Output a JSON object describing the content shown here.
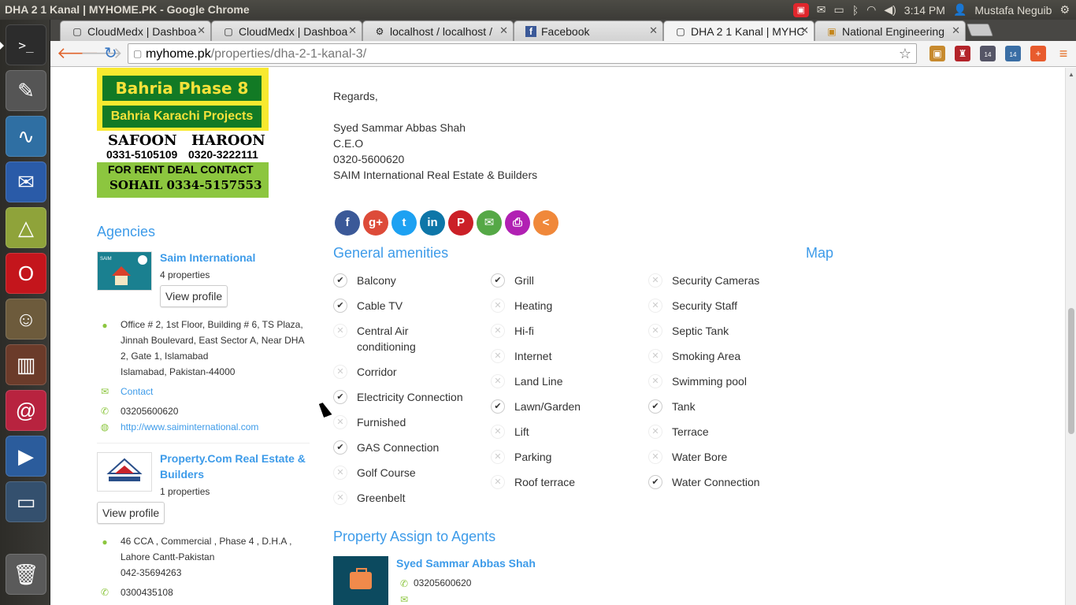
{
  "os": {
    "window_title": "DHA 2 1 Kanal | MYHOME.PK - Google Chrome",
    "clock": "3:14 PM",
    "user": "Mustafa Neguib"
  },
  "launcher": {
    "apps": [
      {
        "name": "terminal-icon",
        "color": "#2c2c2c",
        "glyph": ">_"
      },
      {
        "name": "inkscape-icon",
        "color": "#555",
        "glyph": "✎"
      },
      {
        "name": "system-monitor-icon",
        "color": "#2f6fa3",
        "glyph": "∿"
      },
      {
        "name": "thunderbird-icon",
        "color": "#2a5ba8",
        "glyph": "✉"
      },
      {
        "name": "design-tool-icon",
        "color": "#8fa33a",
        "glyph": "△"
      },
      {
        "name": "opera-icon",
        "color": "#c4151c",
        "glyph": "O"
      },
      {
        "name": "gimp-icon",
        "color": "#6d5b3c",
        "glyph": "☺"
      },
      {
        "name": "books-icon",
        "color": "#6b3b2a",
        "glyph": "▥"
      },
      {
        "name": "app-red-icon",
        "color": "#b8233f",
        "glyph": "@"
      },
      {
        "name": "media-player-icon",
        "color": "#2b5c9c",
        "glyph": "▶"
      },
      {
        "name": "image-viewer-icon",
        "color": "#34506e",
        "glyph": "▭"
      },
      {
        "name": "trash-icon",
        "color": "#5a5a5a",
        "glyph": "🗑"
      }
    ]
  },
  "browser": {
    "tabs": [
      {
        "label": "CloudMedx | Dashboa",
        "fav": "▢"
      },
      {
        "label": "CloudMedx | Dashboa",
        "fav": "▢"
      },
      {
        "label": "localhost / localhost /",
        "fav": "⚙"
      },
      {
        "label": "Facebook",
        "fav": "f"
      },
      {
        "label": "DHA 2 1 Kanal | MYHC",
        "fav": "▢"
      },
      {
        "label": "National Engineering",
        "fav": "▣"
      }
    ],
    "url_domain": "myhome.pk",
    "url_path": "/properties/dha-2-1-kanal-3/",
    "ext_badge_1": "14",
    "ext_badge_2": "14"
  },
  "banner": {
    "line1": "Bahria Phase 8",
    "line2": "Bahria Karachi Projects",
    "name1": "SAFOON",
    "name2": "HAROON",
    "phone1": "0331-5105109",
    "phone2": "0320-3222111",
    "deal": "FOR RENT DEAL CONTACT",
    "contact": "SOHAIL  0334-5157553"
  },
  "agencies": {
    "title": "Agencies",
    "items": [
      {
        "name": "Saim International",
        "count": "4 properties",
        "view_label": "View profile",
        "address1": "Office # 2, 1st Floor, Building # 6, TS Plaza,",
        "address2": "Jinnah Boulevard, East Sector A, Near DHA",
        "address3": "2, Gate 1, Islamabad",
        "address4": "Islamabad, Pakistan-44000",
        "contact": "Contact",
        "phone": "03205600620",
        "website": "http://www.saiminternational.com"
      },
      {
        "name_l1": "Property.Com Real Estate &",
        "name_l2": "Builders",
        "count": "1 properties",
        "view_label": "View profile",
        "address1": "46 CCA , Commercial , Phase 4 , D.H.A ,",
        "address2": "Lahore Cantt-Pakistan",
        "address3": "042-35694263",
        "phone": "0300435108"
      }
    ]
  },
  "signature": {
    "regards": "Regards,",
    "name": "Syed Sammar Abbas Shah",
    "title": "C.E.O",
    "phone": "0320-5600620",
    "company": "SAIM International Real Estate & Builders"
  },
  "share": [
    {
      "name": "facebook-share-icon",
      "color": "#3b5998",
      "glyph": "f"
    },
    {
      "name": "googleplus-share-icon",
      "color": "#dd4b39",
      "glyph": "g+"
    },
    {
      "name": "twitter-share-icon",
      "color": "#1da1f2",
      "glyph": "t"
    },
    {
      "name": "linkedin-share-icon",
      "color": "#0e76a8",
      "glyph": "in"
    },
    {
      "name": "pinterest-share-icon",
      "color": "#cb2027",
      "glyph": "P"
    },
    {
      "name": "email-share-icon",
      "color": "#55a846",
      "glyph": "✉"
    },
    {
      "name": "print-share-icon",
      "color": "#b121b3",
      "glyph": "⎙"
    },
    {
      "name": "more-share-icon",
      "color": "#f0883a",
      "glyph": "<"
    }
  ],
  "amenities": {
    "title": "General amenities",
    "map_title": "Map",
    "col1": [
      {
        "label": "Balcony",
        "on": true
      },
      {
        "label": "Cable TV",
        "on": true
      },
      {
        "label": "Central Air",
        "label2": "conditioning",
        "on": false
      },
      {
        "label": "Corridor",
        "on": false
      },
      {
        "label": "Electricity Connection",
        "on": true
      },
      {
        "label": "Furnished",
        "on": false
      },
      {
        "label": "GAS Connection",
        "on": true
      },
      {
        "label": "Golf Course",
        "on": false
      },
      {
        "label": "Greenbelt",
        "on": false
      }
    ],
    "col2": [
      {
        "label": "Grill",
        "on": true
      },
      {
        "label": "Heating",
        "on": false
      },
      {
        "label": "Hi-fi",
        "on": false
      },
      {
        "label": "Internet",
        "on": false
      },
      {
        "label": "Land Line",
        "on": false
      },
      {
        "label": "Lawn/Garden",
        "on": true
      },
      {
        "label": "Lift",
        "on": false
      },
      {
        "label": "Parking",
        "on": false
      },
      {
        "label": "Roof terrace",
        "on": false
      }
    ],
    "col3": [
      {
        "label": "Security Cameras",
        "on": false
      },
      {
        "label": "Security Staff",
        "on": false
      },
      {
        "label": "Septic Tank",
        "on": false
      },
      {
        "label": "Smoking Area",
        "on": false
      },
      {
        "label": "Swimming pool",
        "on": false
      },
      {
        "label": "Tank",
        "on": true
      },
      {
        "label": "Terrace",
        "on": false
      },
      {
        "label": "Water Bore",
        "on": false
      },
      {
        "label": "Water Connection",
        "on": true
      }
    ]
  },
  "agents": {
    "title": "Property Assign to Agents",
    "name": "Syed Sammar Abbas Shah",
    "phone": "03205600620"
  }
}
